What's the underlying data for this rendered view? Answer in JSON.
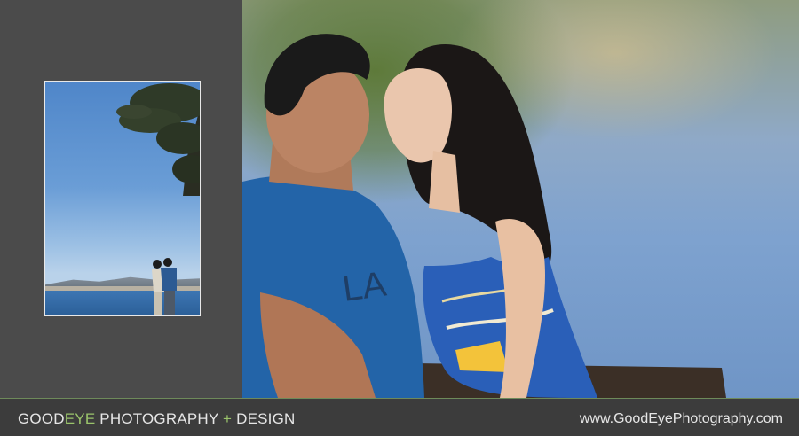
{
  "footer": {
    "brand_good": "GOOD",
    "brand_eye": "EYE",
    "brand_photography": " PHOTOGRAPHY ",
    "brand_plus": "+",
    "brand_design": " DESIGN",
    "website": "www.GoodEyePhotography.com"
  },
  "colors": {
    "accent_green": "#9ac46b",
    "panel_gray": "#4b4b4b",
    "footer_bg": "#3c3c3c"
  },
  "shirt_text": "LA"
}
